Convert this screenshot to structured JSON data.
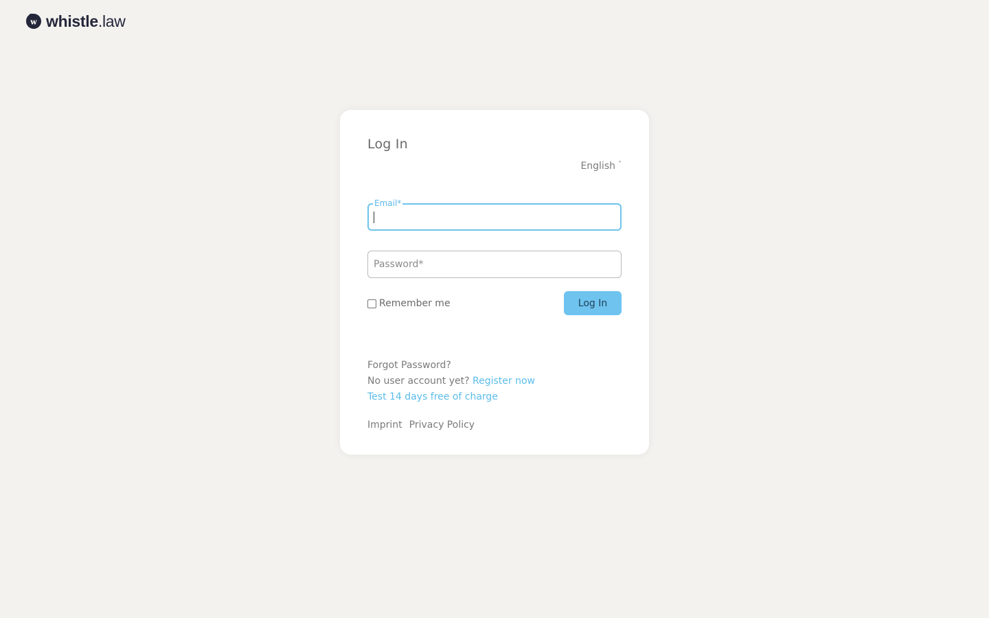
{
  "brand": {
    "name_bold": "whistle",
    "name_light": ".law",
    "mark_letter": "w",
    "mark_color": "#24263a"
  },
  "login": {
    "title": "Log In",
    "language": "English",
    "language_chevron": "˅",
    "email_label": "Email*",
    "email_value": "",
    "password_placeholder": "Password*",
    "password_value": "",
    "remember_label": "Remember me",
    "remember_checked": false,
    "submit_label": "Log In",
    "forgot_label": "Forgot Password?",
    "no_account_text": "No user account yet?",
    "register_label": "Register now",
    "trial_label": "Test 14 days free of charge"
  },
  "footer": {
    "imprint": "Imprint",
    "privacy": "Privacy Policy"
  },
  "colors": {
    "background": "#f3f2ef",
    "accent": "#5cbde9",
    "button": "#6ec3ef"
  }
}
